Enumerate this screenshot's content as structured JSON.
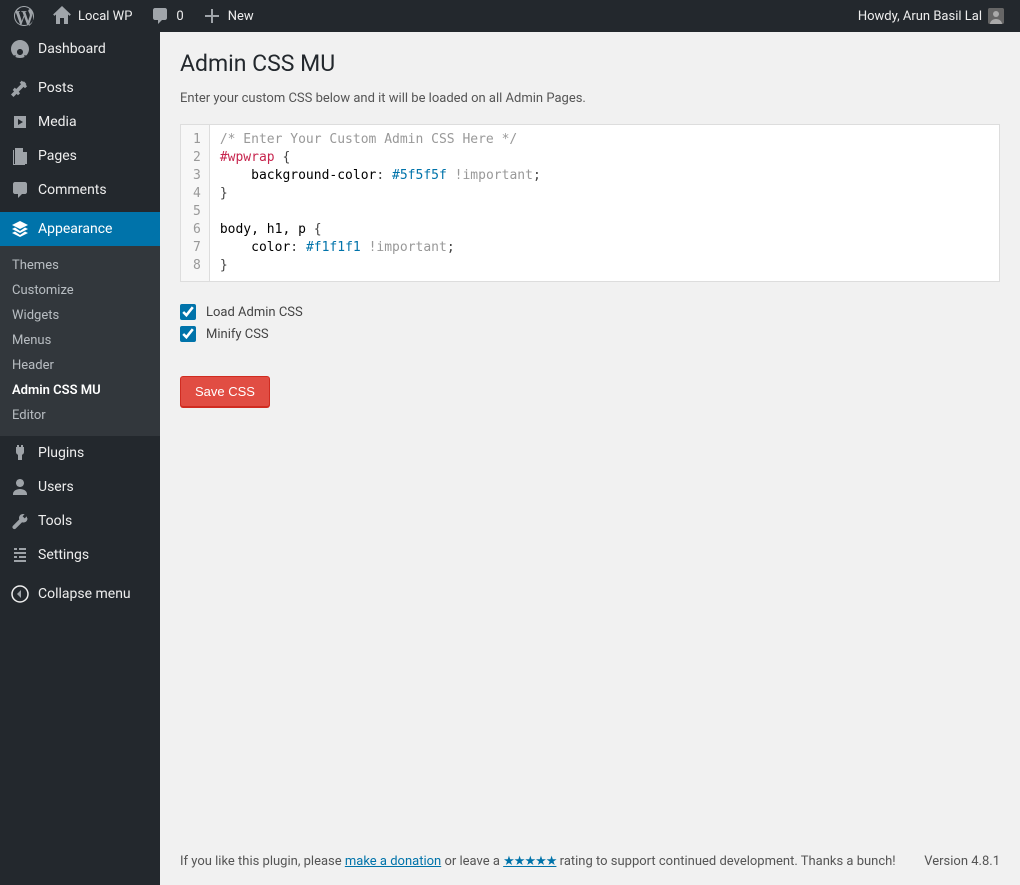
{
  "adminbar": {
    "site_name": "Local WP",
    "comments_count": "0",
    "new_label": "New",
    "howdy": "Howdy, Arun Basil Lal"
  },
  "sidebar": {
    "dashboard": "Dashboard",
    "posts": "Posts",
    "media": "Media",
    "pages": "Pages",
    "comments": "Comments",
    "appearance": "Appearance",
    "submenu": {
      "themes": "Themes",
      "customize": "Customize",
      "widgets": "Widgets",
      "menus": "Menus",
      "header": "Header",
      "admin_css_mu": "Admin CSS MU",
      "editor": "Editor"
    },
    "plugins": "Plugins",
    "users": "Users",
    "tools": "Tools",
    "settings": "Settings",
    "collapse": "Collapse menu"
  },
  "page": {
    "title": "Admin CSS MU",
    "description": "Enter your custom CSS below and it will be loaded on all Admin Pages.",
    "code_lines": [
      {
        "n": 1,
        "segs": [
          {
            "t": "/* Enter Your Custom Admin CSS Here */",
            "c": "c-comment"
          }
        ]
      },
      {
        "n": 2,
        "segs": [
          {
            "t": "#wpwrap",
            "c": "c-selector"
          },
          {
            "t": " {",
            "c": ""
          }
        ]
      },
      {
        "n": 3,
        "segs": [
          {
            "t": "    ",
            "c": ""
          },
          {
            "t": "background-color",
            "c": "c-prop"
          },
          {
            "t": ": ",
            "c": ""
          },
          {
            "t": "#5f5f5f",
            "c": "c-hex"
          },
          {
            "t": " ",
            "c": ""
          },
          {
            "t": "!important",
            "c": "c-important"
          },
          {
            "t": ";",
            "c": ""
          }
        ]
      },
      {
        "n": 4,
        "segs": [
          {
            "t": "}",
            "c": ""
          }
        ]
      },
      {
        "n": 5,
        "segs": [
          {
            "t": "",
            "c": ""
          }
        ]
      },
      {
        "n": 6,
        "segs": [
          {
            "t": "body, h1, p",
            "c": "c-prop"
          },
          {
            "t": " {",
            "c": ""
          }
        ]
      },
      {
        "n": 7,
        "segs": [
          {
            "t": "    ",
            "c": ""
          },
          {
            "t": "color",
            "c": "c-prop"
          },
          {
            "t": ": ",
            "c": ""
          },
          {
            "t": "#f1f1f1",
            "c": "c-hex"
          },
          {
            "t": " ",
            "c": ""
          },
          {
            "t": "!important",
            "c": "c-important"
          },
          {
            "t": ";",
            "c": ""
          }
        ]
      },
      {
        "n": 8,
        "segs": [
          {
            "t": "}",
            "c": ""
          }
        ]
      }
    ],
    "checkboxes": {
      "load_admin_css": {
        "label": "Load Admin CSS",
        "checked": true
      },
      "minify_css": {
        "label": "Minify CSS",
        "checked": true
      }
    },
    "save_button": "Save CSS"
  },
  "footer": {
    "like_prefix": "If you like this plugin, please ",
    "donation_link": "make a donation",
    "or_leave": " or leave a ",
    "stars": "★★★★★",
    "rating_suffix": " rating to support continued development. Thanks a bunch!",
    "version": "Version 4.8.1"
  }
}
